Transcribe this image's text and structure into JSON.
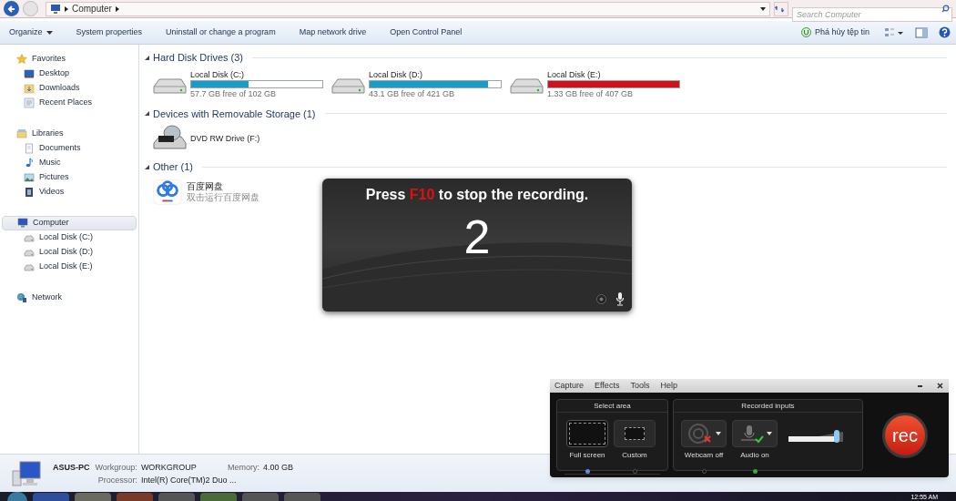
{
  "address_bar": {
    "path": "Computer",
    "search_placeholder": "Search Computer"
  },
  "toolbar": {
    "items": [
      "Organize",
      "System properties",
      "Uninstall or change a program",
      "Map network drive",
      "Open Control Panel"
    ],
    "right_item": "Phá hủy tệp tin"
  },
  "sidebar": [
    {
      "label": "Favorites",
      "kind": "star",
      "selected": false,
      "children": [
        {
          "label": "Desktop",
          "kind": "desktop",
          "selected": false
        },
        {
          "label": "Downloads",
          "kind": "folder",
          "selected": false
        },
        {
          "label": "Recent Places",
          "kind": "recent",
          "selected": false
        }
      ]
    },
    {
      "label": "Libraries",
      "kind": "library",
      "selected": false,
      "children": [
        {
          "label": "Documents",
          "kind": "document",
          "selected": false
        },
        {
          "label": "Music",
          "kind": "music",
          "selected": false
        },
        {
          "label": "Pictures",
          "kind": "picture",
          "selected": false
        },
        {
          "label": "Videos",
          "kind": "video",
          "selected": false
        }
      ]
    },
    {
      "label": "Computer",
      "kind": "computer",
      "selected": true,
      "children": [
        {
          "label": "Local Disk (C:)",
          "kind": "disk",
          "selected": false
        },
        {
          "label": "Local Disk (D:)",
          "kind": "disk",
          "selected": false
        },
        {
          "label": "Local Disk (E:)",
          "kind": "disk",
          "selected": false
        }
      ]
    },
    {
      "label": "Network",
      "kind": "network",
      "selected": false
    }
  ],
  "groups": [
    {
      "title": "Hard Disk Drives (3)",
      "items": [
        {
          "kind": "disk",
          "name": "Local Disk (C:)",
          "level": 0.44,
          "color": "#1a9cc9",
          "free": "57.7 GB free of 102 GB"
        },
        {
          "kind": "disk",
          "name": "Local Disk (D:)",
          "level": 0.9,
          "color": "#1a9cc9",
          "free": "43.1 GB free of 421 GB"
        },
        {
          "kind": "disk",
          "name": "Local Disk (E:)",
          "level": 0.997,
          "color": "#d0101a",
          "free": "1.33 GB free of 407 GB"
        }
      ]
    },
    {
      "title": "Devices with Removable Storage (1)",
      "items": [
        {
          "kind": "dvd",
          "name": "DVD RW Drive (F:)"
        }
      ]
    },
    {
      "title": "Other (1)",
      "items": [
        {
          "kind": "app",
          "name": "百度网盘",
          "subtitle": "双击运行百度网盘"
        }
      ]
    }
  ],
  "details": {
    "computer_name": "ASUS-PC",
    "fields": [
      {
        "label": "Workgroup:",
        "value": "WORKGROUP"
      },
      {
        "label": "Memory:",
        "value": "4.00 GB"
      },
      {
        "label": "Processor:",
        "value": "Intel(R) Core(TM)2 Duo ..."
      }
    ]
  },
  "countdown": {
    "message_start": "Press",
    "key": "F10",
    "message_end": "to stop the recording.",
    "number": "2"
  },
  "recorder": {
    "menu": [
      "Capture",
      "Effects",
      "Tools",
      "Help"
    ],
    "select_area": {
      "title": "Select area",
      "options": [
        {
          "label": "Full screen",
          "selected": true
        },
        {
          "label": "Custom",
          "selected": false
        }
      ]
    },
    "recorded_inputs": {
      "title": "Recorded inputs",
      "inputs": [
        {
          "kind": "webcam",
          "label": "Webcam off",
          "on": false
        },
        {
          "kind": "audio",
          "label": "Audio on",
          "on": true
        }
      ],
      "level": 0.85
    },
    "rec_label": "rec"
  },
  "taskbar": {
    "clock": "12:55 AM"
  }
}
